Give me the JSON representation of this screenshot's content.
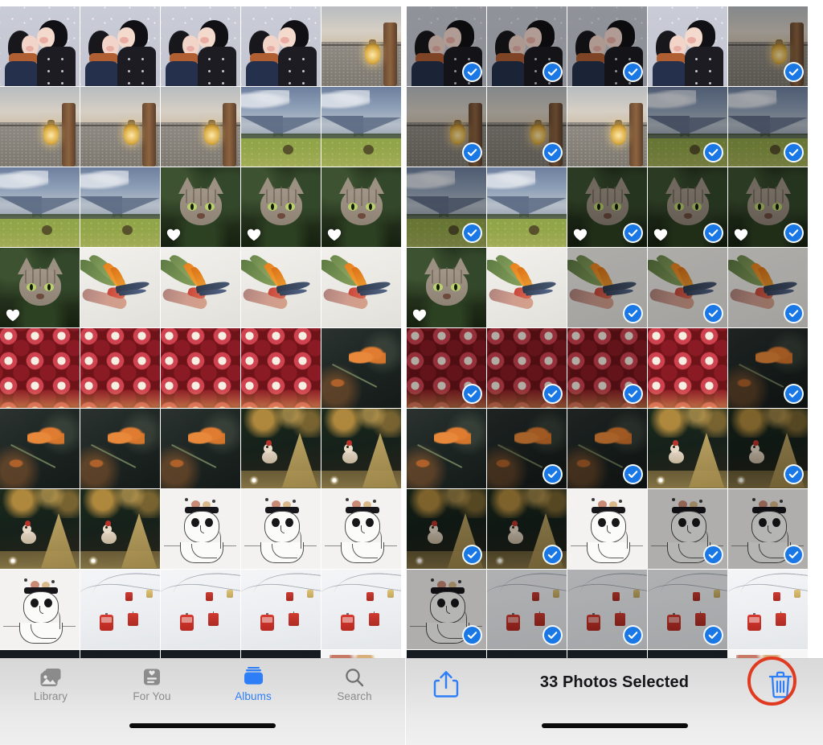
{
  "app": {
    "name": "Photos",
    "accent_color": "#2d7ef7",
    "selection_badge_color": "#1978e5",
    "annotation_color": "#e03a20"
  },
  "left_panel": {
    "name": "photos-grid-browse-state",
    "tabbar": {
      "tabs": [
        {
          "label": "Library",
          "icon": "library-icon",
          "active": false
        },
        {
          "label": "For You",
          "icon": "for-you-icon",
          "active": false
        },
        {
          "label": "Albums",
          "icon": "albums-icon",
          "active": true
        },
        {
          "label": "Search",
          "icon": "search-icon",
          "active": false
        }
      ]
    }
  },
  "right_panel": {
    "name": "photos-grid-selection-state",
    "toolbar": {
      "share_label": "share-icon",
      "selection_text": "33 Photos Selected",
      "delete_label": "trash-icon",
      "annotation": "red-circle-highlight"
    }
  },
  "grid": {
    "columns": 5,
    "cell_size": 99,
    "rows": 8,
    "partial_row_visible": true,
    "left_cells": [
      {
        "art": "couple",
        "favorite": false,
        "selected": false
      },
      {
        "art": "couple",
        "favorite": false,
        "selected": false
      },
      {
        "art": "couple",
        "favorite": false,
        "selected": false
      },
      {
        "art": "couple",
        "favorite": false,
        "selected": false
      },
      {
        "art": "lantern",
        "favorite": false,
        "selected": false
      },
      {
        "art": "lantern",
        "favorite": false,
        "selected": false
      },
      {
        "art": "lantern",
        "favorite": false,
        "selected": false
      },
      {
        "art": "lantern",
        "favorite": false,
        "selected": false
      },
      {
        "art": "field",
        "favorite": false,
        "selected": false
      },
      {
        "art": "field",
        "favorite": false,
        "selected": false
      },
      {
        "art": "field",
        "favorite": false,
        "selected": false
      },
      {
        "art": "field",
        "favorite": false,
        "selected": false
      },
      {
        "art": "cat",
        "favorite": true,
        "selected": false
      },
      {
        "art": "cat",
        "favorite": true,
        "selected": false
      },
      {
        "art": "cat",
        "favorite": true,
        "selected": false
      },
      {
        "art": "cat",
        "favorite": true,
        "selected": false
      },
      {
        "art": "bird",
        "favorite": false,
        "selected": false
      },
      {
        "art": "bird",
        "favorite": false,
        "selected": false
      },
      {
        "art": "bird",
        "favorite": false,
        "selected": false
      },
      {
        "art": "bird",
        "favorite": false,
        "selected": false
      },
      {
        "art": "pom",
        "favorite": false,
        "selected": false
      },
      {
        "art": "pom",
        "favorite": false,
        "selected": false
      },
      {
        "art": "pom",
        "favorite": false,
        "selected": false
      },
      {
        "art": "pom",
        "favorite": false,
        "selected": false
      },
      {
        "art": "flower",
        "favorite": false,
        "selected": false
      },
      {
        "art": "flower",
        "favorite": false,
        "selected": false
      },
      {
        "art": "flower",
        "favorite": false,
        "selected": false
      },
      {
        "art": "flower",
        "favorite": false,
        "selected": false
      },
      {
        "art": "xmas",
        "favorite": false,
        "selected": false
      },
      {
        "art": "xmas",
        "favorite": false,
        "selected": false
      },
      {
        "art": "xmas",
        "favorite": false,
        "selected": false
      },
      {
        "art": "xmas",
        "favorite": false,
        "selected": false
      },
      {
        "art": "sketch",
        "favorite": false,
        "selected": false
      },
      {
        "art": "sketch",
        "favorite": false,
        "selected": false
      },
      {
        "art": "sketch",
        "favorite": false,
        "selected": false
      },
      {
        "art": "sketch",
        "favorite": false,
        "selected": false
      },
      {
        "art": "cable",
        "favorite": false,
        "selected": false
      },
      {
        "art": "cable",
        "favorite": false,
        "selected": false
      },
      {
        "art": "cable",
        "favorite": false,
        "selected": false
      },
      {
        "art": "cable",
        "favorite": false,
        "selected": false
      },
      {
        "art": "dark",
        "favorite": false,
        "selected": false
      },
      {
        "art": "dark",
        "favorite": false,
        "selected": false
      },
      {
        "art": "dark",
        "favorite": false,
        "selected": false
      },
      {
        "art": "dark",
        "favorite": false,
        "selected": false
      },
      {
        "art": "white",
        "favorite": false,
        "selected": false
      }
    ],
    "right_cells": [
      {
        "art": "couple",
        "favorite": false,
        "selected": true
      },
      {
        "art": "couple",
        "favorite": false,
        "selected": true
      },
      {
        "art": "couple",
        "favorite": false,
        "selected": true
      },
      {
        "art": "couple",
        "favorite": false,
        "selected": false
      },
      {
        "art": "lantern",
        "favorite": false,
        "selected": true
      },
      {
        "art": "lantern",
        "favorite": false,
        "selected": true
      },
      {
        "art": "lantern",
        "favorite": false,
        "selected": true
      },
      {
        "art": "lantern",
        "favorite": false,
        "selected": false
      },
      {
        "art": "field",
        "favorite": false,
        "selected": true
      },
      {
        "art": "field",
        "favorite": false,
        "selected": true
      },
      {
        "art": "field",
        "favorite": false,
        "selected": true
      },
      {
        "art": "field",
        "favorite": false,
        "selected": false
      },
      {
        "art": "cat",
        "favorite": true,
        "selected": true
      },
      {
        "art": "cat",
        "favorite": true,
        "selected": true
      },
      {
        "art": "cat",
        "favorite": true,
        "selected": true
      },
      {
        "art": "cat",
        "favorite": true,
        "selected": false
      },
      {
        "art": "bird",
        "favorite": false,
        "selected": false
      },
      {
        "art": "bird",
        "favorite": false,
        "selected": true
      },
      {
        "art": "bird",
        "favorite": false,
        "selected": true
      },
      {
        "art": "bird",
        "favorite": false,
        "selected": true
      },
      {
        "art": "pom",
        "favorite": false,
        "selected": true
      },
      {
        "art": "pom",
        "favorite": false,
        "selected": true
      },
      {
        "art": "pom",
        "favorite": false,
        "selected": true
      },
      {
        "art": "pom",
        "favorite": false,
        "selected": false
      },
      {
        "art": "flower",
        "favorite": false,
        "selected": true
      },
      {
        "art": "flower",
        "favorite": false,
        "selected": false
      },
      {
        "art": "flower",
        "favorite": false,
        "selected": true
      },
      {
        "art": "flower",
        "favorite": false,
        "selected": true
      },
      {
        "art": "xmas",
        "favorite": false,
        "selected": false
      },
      {
        "art": "xmas",
        "favorite": false,
        "selected": true
      },
      {
        "art": "xmas",
        "favorite": false,
        "selected": true
      },
      {
        "art": "xmas",
        "favorite": false,
        "selected": true
      },
      {
        "art": "sketch",
        "favorite": false,
        "selected": false
      },
      {
        "art": "sketch",
        "favorite": false,
        "selected": true
      },
      {
        "art": "sketch",
        "favorite": false,
        "selected": true
      },
      {
        "art": "sketch",
        "favorite": false,
        "selected": true
      },
      {
        "art": "cable",
        "favorite": false,
        "selected": true
      },
      {
        "art": "cable",
        "favorite": false,
        "selected": true
      },
      {
        "art": "cable",
        "favorite": false,
        "selected": true
      },
      {
        "art": "cable",
        "favorite": false,
        "selected": false
      },
      {
        "art": "dark",
        "favorite": false,
        "selected": false
      },
      {
        "art": "dark",
        "favorite": false,
        "selected": false
      },
      {
        "art": "dark",
        "favorite": false,
        "selected": false
      },
      {
        "art": "dark",
        "favorite": false,
        "selected": false
      },
      {
        "art": "white",
        "favorite": false,
        "selected": false
      }
    ]
  }
}
